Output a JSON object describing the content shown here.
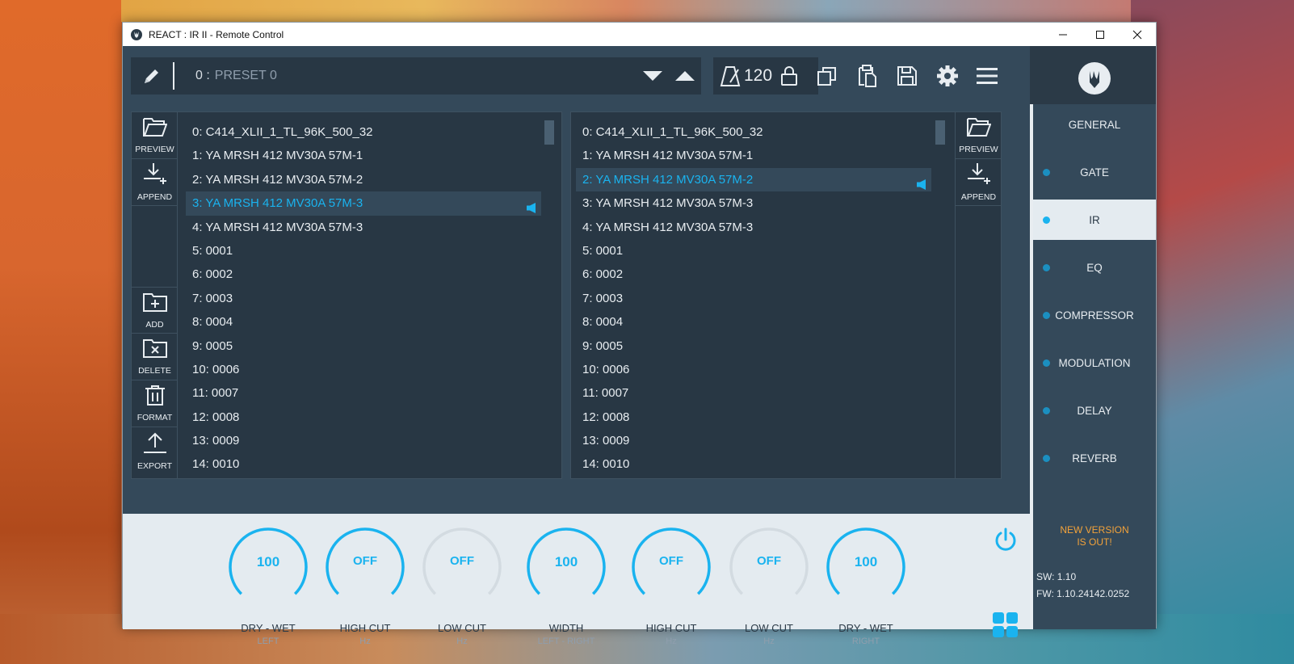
{
  "window": {
    "title": "REACT : IR II - Remote Control"
  },
  "toolbar": {
    "preset_number": "0 :",
    "preset_name": "PRESET 0",
    "tempo": "120"
  },
  "left_pane": {
    "tools": [
      {
        "label": "PREVIEW",
        "icon": "folder-open-icon"
      },
      {
        "label": "APPEND",
        "icon": "download-plus-icon"
      },
      {
        "label": "ADD",
        "icon": "folder-plus-icon"
      },
      {
        "label": "DELETE",
        "icon": "folder-x-icon"
      },
      {
        "label": "FORMAT",
        "icon": "trash-icon"
      },
      {
        "label": "EXPORT",
        "icon": "upload-icon"
      }
    ],
    "items": [
      "0: C414_XLII_1_TL_96K_500_32",
      "1: YA MRSH 412 MV30A 57M-1",
      "2: YA MRSH 412 MV30A 57M-2",
      "3: YA MRSH 412 MV30A 57M-3",
      "4: YA MRSH 412 MV30A 57M-3",
      "5: 0001",
      "6: 0002",
      "7: 0003",
      "8: 0004",
      "9: 0005",
      "10: 0006",
      "11: 0007",
      "12: 0008",
      "13: 0009",
      "14: 0010"
    ],
    "selected_index": 3
  },
  "right_pane": {
    "tools": [
      {
        "label": "PREVIEW",
        "icon": "folder-open-icon"
      },
      {
        "label": "APPEND",
        "icon": "download-plus-icon"
      }
    ],
    "items": [
      "0: C414_XLII_1_TL_96K_500_32",
      "1: YA MRSH 412 MV30A 57M-1",
      "2: YA MRSH 412 MV30A 57M-2",
      "3: YA MRSH 412 MV30A 57M-3",
      "4: YA MRSH 412 MV30A 57M-3",
      "5: 0001",
      "6: 0002",
      "7: 0003",
      "8: 0004",
      "9: 0005",
      "10: 0006",
      "11: 0007",
      "12: 0008",
      "13: 0009",
      "14: 0010"
    ],
    "selected_index": 2
  },
  "nav": {
    "items": [
      "GENERAL",
      "GATE",
      "IR",
      "EQ",
      "COMPRESSOR",
      "MODULATION",
      "DELAY",
      "REVERB"
    ],
    "active": "IR",
    "new_version_line1": "NEW VERSION",
    "new_version_line2": "IS OUT!",
    "sw": "SW: 1.10",
    "fw": "FW: 1.10.24142.0252"
  },
  "knobs": [
    {
      "value": "100",
      "label": "DRY - WET",
      "sub": "LEFT",
      "active": true
    },
    {
      "value": "OFF",
      "label": "HIGH CUT",
      "sub": "Hz",
      "active": true
    },
    {
      "value": "OFF",
      "label": "LOW CUT",
      "sub": "Hz",
      "active": false
    },
    {
      "value": "100",
      "label": "WIDTH",
      "sub": "LEFT - RIGHT",
      "active": true
    },
    {
      "value": "OFF",
      "label": "HIGH CUT",
      "sub": "Hz",
      "active": true
    },
    {
      "value": "OFF",
      "label": "LOW CUT",
      "sub": "Hz",
      "active": false
    },
    {
      "value": "100",
      "label": "DRY - WET",
      "sub": "RIGHT",
      "active": true
    }
  ],
  "colors": {
    "accent": "#1ab3ef",
    "panel": "#283744",
    "panel_light": "#34495a",
    "bottom_bg": "#e4ebf0",
    "warning": "#f2a23a"
  }
}
